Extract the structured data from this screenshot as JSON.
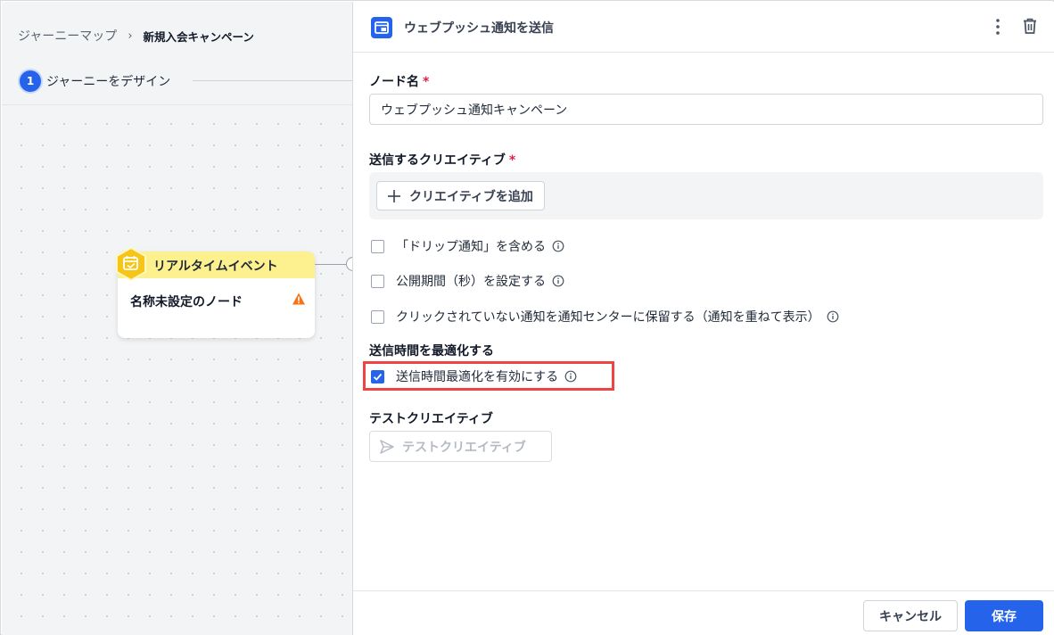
{
  "breadcrumb": {
    "root": "ジャーニーマップ",
    "separator": "›",
    "current": "新規入会キャンペーン"
  },
  "stepper": {
    "number": "1",
    "label": "ジャーニーをデザイン"
  },
  "node": {
    "type_label": "リアルタイムイベント",
    "name": "名称未設定のノード",
    "icon": "calendar-check-icon",
    "warning_icon": "warning-triangle-icon",
    "header_color": "#fdf08e",
    "hex_color": "#f5c518"
  },
  "panel": {
    "title": "ウェブプッシュ通知を送信",
    "title_icon": "web-push-icon",
    "menu_icon": "kebab-menu-icon",
    "delete_icon": "trash-icon",
    "node_name_label": "ノード名",
    "node_name_value": "ウェブプッシュ通知キャンペーン",
    "required_mark": "*",
    "creative_label": "送信するクリエイティブ",
    "add_creative_button": "クリエイティブを追加",
    "options": [
      {
        "label": "「ドリップ通知」を含める",
        "checked": false
      },
      {
        "label": "公開期間（秒）を設定する",
        "checked": false
      },
      {
        "label": "クリックされていない通知を通知センターに保留する（通知を重ねて表示）",
        "checked": false
      }
    ],
    "optimize_section_label": "送信時間を最適化する",
    "optimize_option": {
      "label": "送信時間最適化を有効にする",
      "checked": true
    },
    "test_section_label": "テストクリエイティブ",
    "test_button": "テストクリエイティブ"
  },
  "footer": {
    "cancel_button": "キャンセル",
    "save_button": "保存"
  },
  "colors": {
    "accent": "#2563eb",
    "highlight": "#ef4444",
    "required": "#e11d48"
  }
}
